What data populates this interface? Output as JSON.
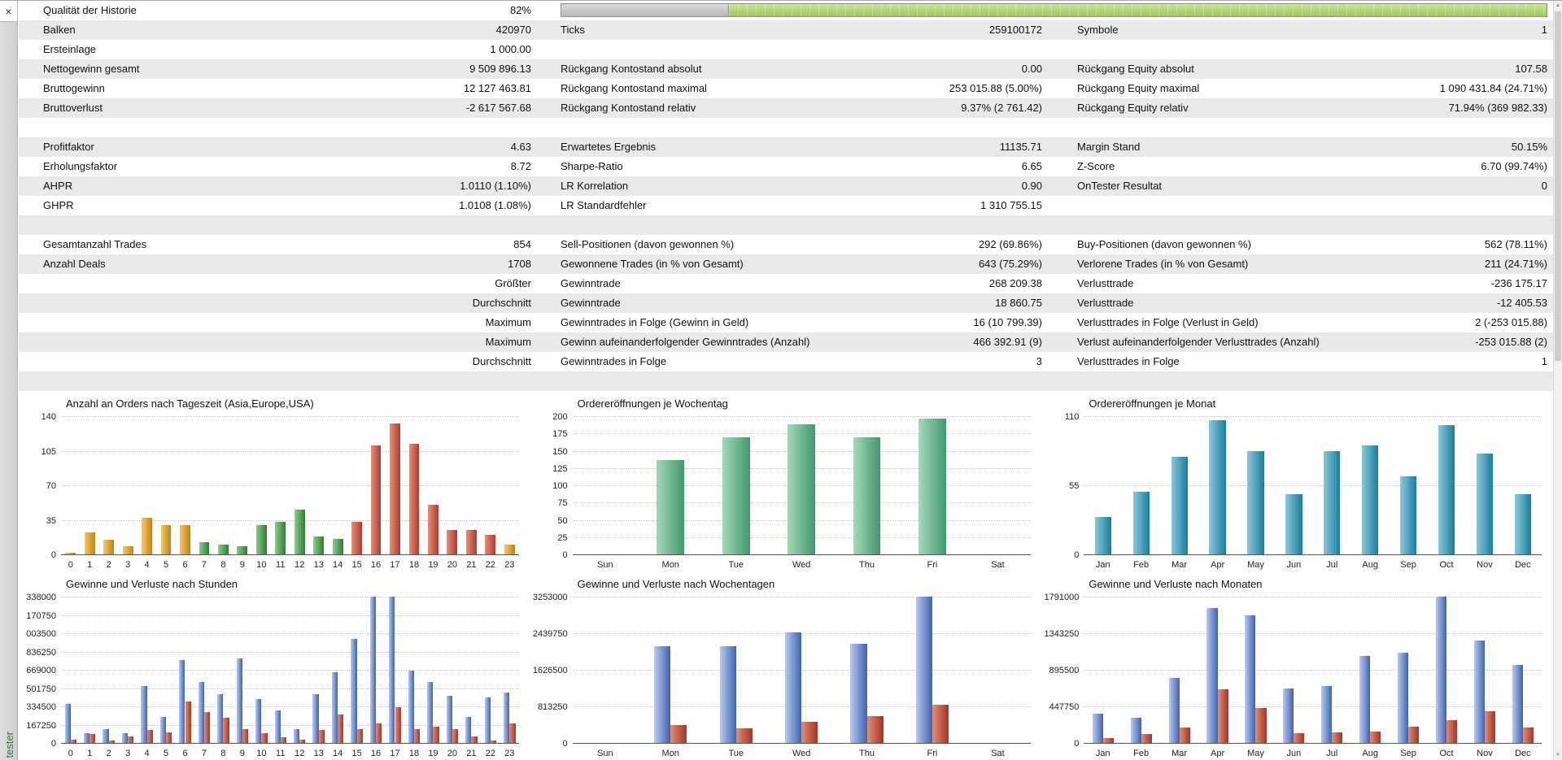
{
  "panel": {
    "tab_label": "tester",
    "close_icon": "×",
    "scroll_up_icon": "▲",
    "scroll_down_icon": "▼"
  },
  "stats": {
    "quality_bar": {
      "gray_pct": 17,
      "green_pct": 83,
      "gray_color": "#bdbdbd",
      "green_color": "#9cc653"
    },
    "rows": [
      {
        "quality": true,
        "cells": [
          {
            "l": "Qualität der Historie",
            "v": "82%"
          }
        ]
      },
      {
        "cells": [
          {
            "l": "Balken",
            "v": "420970"
          },
          {
            "l": "Ticks",
            "v": "259100172"
          },
          {
            "l": "Symbole",
            "v": "1"
          }
        ]
      },
      {
        "cells": [
          {
            "l": "Ersteinlage",
            "v": "1 000.00"
          },
          null,
          null
        ]
      },
      {
        "cells": [
          {
            "l": "Nettogewinn gesamt",
            "v": "9 509 896.13"
          },
          {
            "l": "Rückgang Kontostand absolut",
            "v": "0.00"
          },
          {
            "l": "Rückgang Equity absolut",
            "v": "107.58"
          }
        ]
      },
      {
        "cells": [
          {
            "l": "Bruttogewinn",
            "v": "12 127 463.81"
          },
          {
            "l": "Rückgang Kontostand maximal",
            "v": "253 015.88 (5.00%)"
          },
          {
            "l": "Rückgang Equity maximal",
            "v": "1 090 431.84 (24.71%)"
          }
        ]
      },
      {
        "cells": [
          {
            "l": "Bruttoverlust",
            "v": "-2 617 567.68"
          },
          {
            "l": "Rückgang Kontostand relativ",
            "v": "9.37% (2 761.42)"
          },
          {
            "l": "Rückgang Equity relativ",
            "v": "71.94% (369 982.33)"
          }
        ]
      },
      {
        "cells": []
      },
      {
        "cells": [
          {
            "l": "Profitfaktor",
            "v": "4.63"
          },
          {
            "l": "Erwartetes Ergebnis",
            "v": "11135.71"
          },
          {
            "l": "Margin Stand",
            "v": "50.15%"
          }
        ]
      },
      {
        "cells": [
          {
            "l": "Erholungsfaktor",
            "v": "8.72"
          },
          {
            "l": "Sharpe-Ratio",
            "v": "6.65"
          },
          {
            "l": "Z-Score",
            "v": "6.70 (99.74%)"
          }
        ]
      },
      {
        "cells": [
          {
            "l": "AHPR",
            "v": "1.0110 (1.10%)"
          },
          {
            "l": "LR Korrelation",
            "v": "0.90"
          },
          {
            "l": "OnTester Resultat",
            "v": "0"
          }
        ]
      },
      {
        "cells": [
          {
            "l": "GHPR",
            "v": "1.0108 (1.08%)"
          },
          {
            "l": "LR Standardfehler",
            "v": "1 310 755.15"
          },
          null
        ]
      },
      {
        "cells": []
      },
      {
        "cells": [
          {
            "l": "Gesamtanzahl Trades",
            "v": "854"
          },
          {
            "l": "Sell-Positionen (davon gewonnen %)",
            "v": "292 (69.86%)"
          },
          {
            "l": "Buy-Positionen (davon gewonnen %)",
            "v": "562 (78.11%)"
          }
        ]
      },
      {
        "cells": [
          {
            "l": "Anzahl Deals",
            "v": "1708"
          },
          {
            "l": "Gewonnene Trades (in % von Gesamt)",
            "v": "643 (75.29%)"
          },
          {
            "l": "Verlorene Trades (in % von Gesamt)",
            "v": "211 (24.71%)"
          }
        ]
      },
      {
        "cells": [
          {
            "l": "",
            "v": "Größter"
          },
          {
            "l": "Gewinntrade",
            "v": "268 209.38"
          },
          {
            "l": "Verlusttrade",
            "v": "-236 175.17"
          }
        ]
      },
      {
        "cells": [
          {
            "l": "",
            "v": "Durchschnitt"
          },
          {
            "l": "Gewinntrade",
            "v": "18 860.75"
          },
          {
            "l": "Verlusttrade",
            "v": "-12 405.53"
          }
        ]
      },
      {
        "cells": [
          {
            "l": "",
            "v": "Maximum"
          },
          {
            "l": "Gewinntrades in Folge (Gewinn in Geld)",
            "v": "16 (10 799.39)"
          },
          {
            "l": "Verlusttrades in Folge (Verlust in Geld)",
            "v": "2 (-253 015.88)"
          }
        ]
      },
      {
        "cells": [
          {
            "l": "",
            "v": "Maximum"
          },
          {
            "l": "Gewinn aufeinanderfolgender Gewinntrades (Anzahl)",
            "v": "466 392.91 (9)"
          },
          {
            "l": "Verlust aufeinanderfolgender Verlusttrades (Anzahl)",
            "v": "-253 015.88 (2)"
          }
        ]
      },
      {
        "cells": [
          {
            "l": "",
            "v": "Durchschnitt"
          },
          {
            "l": "Gewinntrades in Folge",
            "v": "3"
          },
          {
            "l": "Verlusttrades in Folge",
            "v": "1"
          }
        ]
      },
      {
        "cells": []
      }
    ]
  },
  "palettes": {
    "asia": {
      "light": "#f3c96e",
      "dark": "#c2820f"
    },
    "europe": {
      "light": "#8ecb8e",
      "dark": "#2f7d32"
    },
    "usa": {
      "light": "#e2907b",
      "dark": "#b03a2e"
    },
    "green": {
      "light": "#a5d8b8",
      "dark": "#43986b"
    },
    "teal": {
      "light": "#8ec7da",
      "dark": "#177e9e"
    },
    "profit": {
      "light": "#b9c9ef",
      "dark": "#3f62b0"
    },
    "loss": {
      "light": "#dc9176",
      "dark": "#a93226"
    }
  },
  "chart_data": [
    {
      "type": "bar",
      "title": "Anzahl an Orders nach Tageszeit (Asia,Europe,USA)",
      "categories": [
        "0",
        "1",
        "2",
        "3",
        "4",
        "5",
        "6",
        "7",
        "8",
        "9",
        "10",
        "11",
        "12",
        "13",
        "14",
        "15",
        "16",
        "17",
        "18",
        "19",
        "20",
        "21",
        "22",
        "23"
      ],
      "values": [
        2,
        22,
        15,
        8,
        37,
        30,
        30,
        12,
        10,
        8,
        30,
        33,
        45,
        18,
        16,
        33,
        110,
        133,
        112,
        50,
        25,
        25,
        20,
        10
      ],
      "value_colors": [
        "asia",
        "asia",
        "asia",
        "asia",
        "asia",
        "asia",
        "asia",
        "europe",
        "europe",
        "europe",
        "europe",
        "europe",
        "europe",
        "europe",
        "europe",
        "usa",
        "usa",
        "usa",
        "usa",
        "usa",
        "usa",
        "usa",
        "usa",
        "asia"
      ],
      "y_ticks": [
        0,
        35,
        70,
        105,
        140
      ],
      "ylim": [
        0,
        140
      ],
      "xlabel": "",
      "ylabel": "",
      "grid": true,
      "legend": "none"
    },
    {
      "type": "bar",
      "title": "Ordereröffnungen je Wochentag",
      "categories": [
        "Sun",
        "Mon",
        "Tue",
        "Wed",
        "Thu",
        "Fri",
        "Sat"
      ],
      "values": [
        0,
        137,
        170,
        188,
        170,
        197,
        0
      ],
      "palette": "green",
      "y_ticks": [
        0,
        25,
        50,
        75,
        100,
        125,
        150,
        175,
        200
      ],
      "ylim": [
        0,
        200
      ],
      "xlabel": "",
      "ylabel": "",
      "grid": true,
      "legend": "none"
    },
    {
      "type": "bar",
      "title": "Ordereröffnungen je Monat",
      "categories": [
        "Jan",
        "Feb",
        "Mar",
        "Apr",
        "May",
        "Jun",
        "Jul",
        "Aug",
        "Sep",
        "Oct",
        "Nov",
        "Dec"
      ],
      "values": [
        30,
        50,
        78,
        107,
        82,
        48,
        82,
        87,
        62,
        103,
        80,
        48
      ],
      "palette": "teal",
      "y_ticks": [
        0,
        55,
        110
      ],
      "ylim": [
        0,
        110
      ],
      "xlabel": "",
      "ylabel": "",
      "grid": true,
      "legend": "none"
    },
    {
      "type": "bar",
      "title": "Gewinne und Verluste nach Stunden",
      "categories": [
        "0",
        "1",
        "2",
        "3",
        "4",
        "5",
        "6",
        "7",
        "8",
        "9",
        "10",
        "11",
        "12",
        "13",
        "14",
        "15",
        "16",
        "17",
        "18",
        "19",
        "20",
        "21",
        "22",
        "23"
      ],
      "series": [
        {
          "name": "Gewinne",
          "values": [
            360000,
            90000,
            130000,
            90000,
            520000,
            240000,
            760000,
            560000,
            450000,
            770000,
            400000,
            300000,
            130000,
            450000,
            650000,
            950000,
            1335000,
            1338000,
            660000,
            560000,
            430000,
            240000,
            420000,
            460000
          ]
        },
        {
          "name": "Verluste",
          "values": [
            30000,
            80000,
            20000,
            60000,
            120000,
            100000,
            380000,
            280000,
            230000,
            130000,
            90000,
            50000,
            30000,
            120000,
            260000,
            130000,
            180000,
            330000,
            130000,
            150000,
            130000,
            60000,
            20000,
            180000
          ]
        }
      ],
      "series_palettes": [
        "profit",
        "loss"
      ],
      "y_ticks": [
        0,
        167250,
        334500,
        501750,
        669000,
        836250,
        1003500,
        1170750,
        1338000
      ],
      "y_tick_labels": [
        "0",
        "167250",
        "334500",
        "501750",
        "669000",
        "836250",
        "003500",
        "170750",
        "338000"
      ],
      "ylim": [
        0,
        1338000
      ],
      "xlabel": "",
      "ylabel": "",
      "grid": true,
      "legend": "none"
    },
    {
      "type": "bar",
      "title": "Gewinne und Verluste nach Wochentagen",
      "categories": [
        "Sun",
        "Mon",
        "Tue",
        "Wed",
        "Thu",
        "Fri",
        "Sat"
      ],
      "series": [
        {
          "name": "Gewinne",
          "values": [
            0,
            2150000,
            2150000,
            2450000,
            2200000,
            3253000,
            0
          ]
        },
        {
          "name": "Verluste",
          "values": [
            0,
            400000,
            330000,
            470000,
            590000,
            850000,
            0
          ]
        }
      ],
      "series_palettes": [
        "profit",
        "loss"
      ],
      "y_ticks": [
        0,
        813250,
        1626500,
        2439750,
        3253000
      ],
      "ylim": [
        0,
        3253000
      ],
      "xlabel": "",
      "ylabel": "",
      "grid": true,
      "legend": "none"
    },
    {
      "type": "bar",
      "title": "Gewinne und Verluste nach Monaten",
      "categories": [
        "Jan",
        "Feb",
        "Mar",
        "Apr",
        "May",
        "Jun",
        "Jul",
        "Aug",
        "Sep",
        "Oct",
        "Nov",
        "Dec"
      ],
      "series": [
        {
          "name": "Gewinne",
          "values": [
            360000,
            310000,
            800000,
            1650000,
            1560000,
            670000,
            700000,
            1070000,
            1100000,
            1791000,
            1250000,
            960000
          ]
        },
        {
          "name": "Verluste",
          "values": [
            60000,
            110000,
            190000,
            660000,
            430000,
            120000,
            130000,
            140000,
            200000,
            280000,
            390000,
            190000
          ]
        }
      ],
      "series_palettes": [
        "profit",
        "loss"
      ],
      "y_ticks": [
        0,
        447750,
        895500,
        1343250,
        1791000
      ],
      "ylim": [
        0,
        1791000
      ],
      "xlabel": "",
      "ylabel": "",
      "grid": true,
      "legend": "none"
    }
  ]
}
